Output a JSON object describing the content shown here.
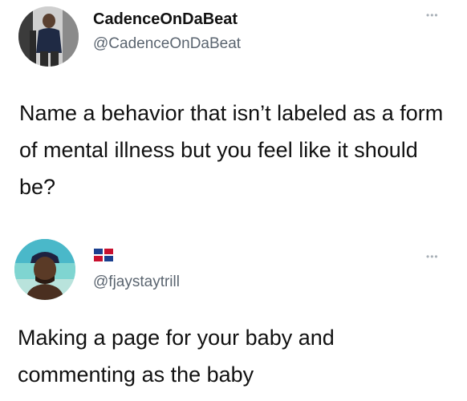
{
  "main_tweet": {
    "display_name": "CadenceOnDaBeat",
    "handle": "@CadenceOnDaBeat",
    "text": "Name a behavior that isn’t labeled as a form of mental illness but you feel like it should be?",
    "more_icon": "more-options-icon"
  },
  "reply_tweet": {
    "handle": "@fjaystaytrill",
    "flag_icon": "dominican-republic-flag-icon",
    "text": "Making a page for your baby and commenting as the baby",
    "more_icon": "more-options-icon"
  },
  "colors": {
    "text": "#111111",
    "handle": "#5b6570",
    "muted_icon": "#a9b1b8",
    "background": "#ffffff"
  }
}
